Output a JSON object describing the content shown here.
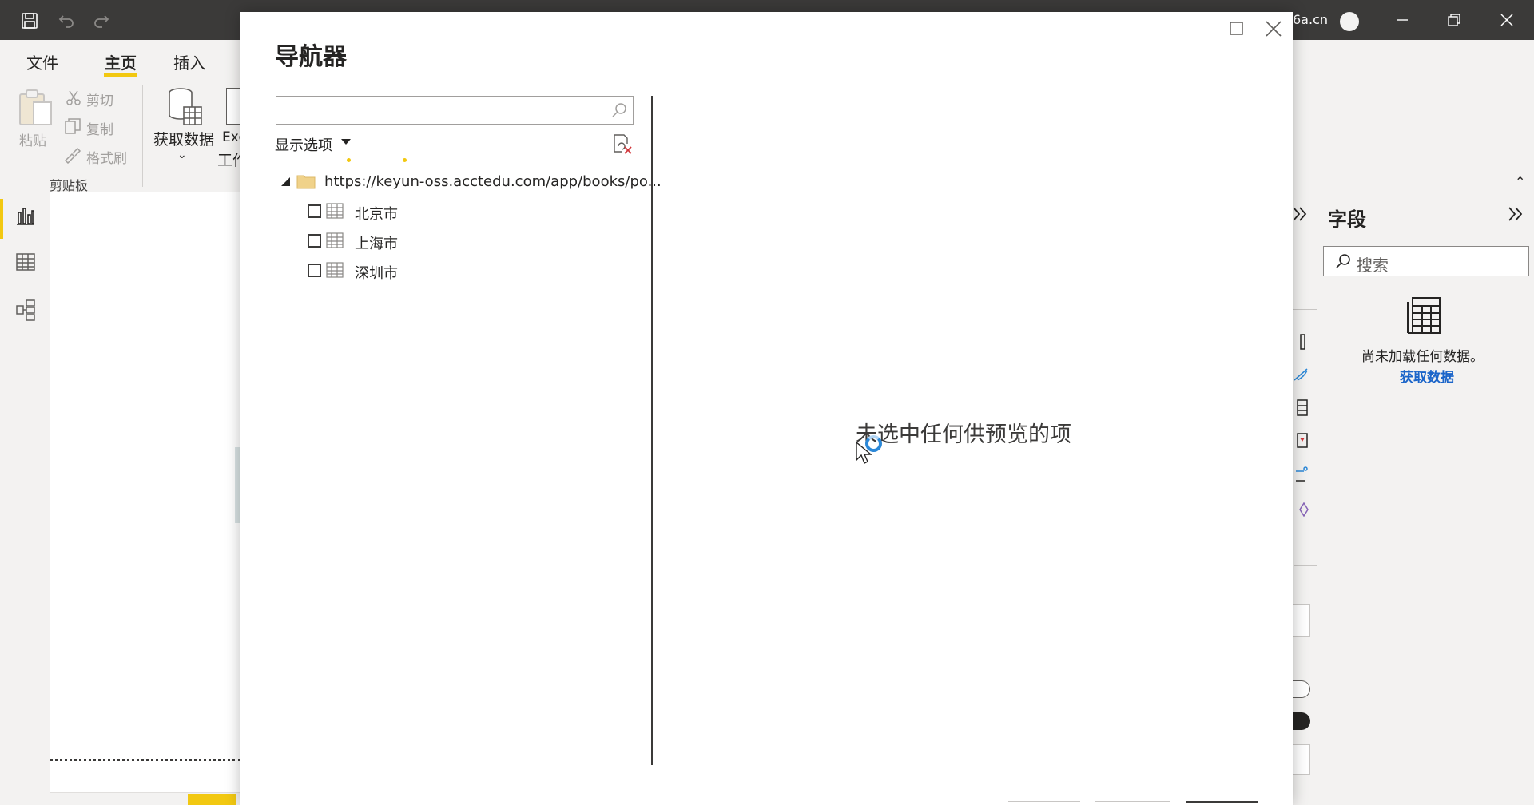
{
  "titlebar": {
    "user": "6a.cn"
  },
  "ribbon": {
    "tabs": [
      "文件",
      "主页",
      "插入"
    ],
    "paste_label": "粘贴",
    "cut_label": "剪切",
    "copy_label": "复制",
    "format_painter_label": "格式刷",
    "clipboard_group_label": "剪贴板",
    "get_data_label": "获取数据",
    "get_data_chevron": "⌄",
    "excel_label_line1": "Exc",
    "excel_label_line2": "工作",
    "collapse_glyph": "⌃"
  },
  "fields_pane": {
    "title": "字段",
    "search_placeholder": "搜索",
    "empty_message": "尚未加载任何数据。",
    "get_data_link": "获取数据"
  },
  "navigator": {
    "title": "导航器",
    "search_value": "",
    "display_options_label": "显示选项",
    "source_url": "https://keyun-oss.acctedu.com/app/books/po...",
    "items": [
      {
        "label": "北京市",
        "checked": false
      },
      {
        "label": "上海市",
        "checked": false
      },
      {
        "label": "深圳市",
        "checked": false
      }
    ],
    "preview_empty_message": "未选中任何供预览的项"
  },
  "colors": {
    "accent": "#f2c811",
    "titlebar": "#3b3a39",
    "link": "#1b65c9"
  },
  "icons": [
    "save-icon",
    "undo-icon",
    "redo-icon",
    "minimize-icon",
    "restore-icon",
    "close-icon",
    "paste-icon",
    "cut-icon",
    "copy-icon",
    "format-painter-icon",
    "get-data-icon",
    "report-view-icon",
    "data-view-icon",
    "model-view-icon",
    "search-icon",
    "table-icon",
    "folder-icon",
    "refresh-icon",
    "chevron-double-right-icon",
    "busy-ring-icon",
    "mouse-cursor-icon"
  ]
}
